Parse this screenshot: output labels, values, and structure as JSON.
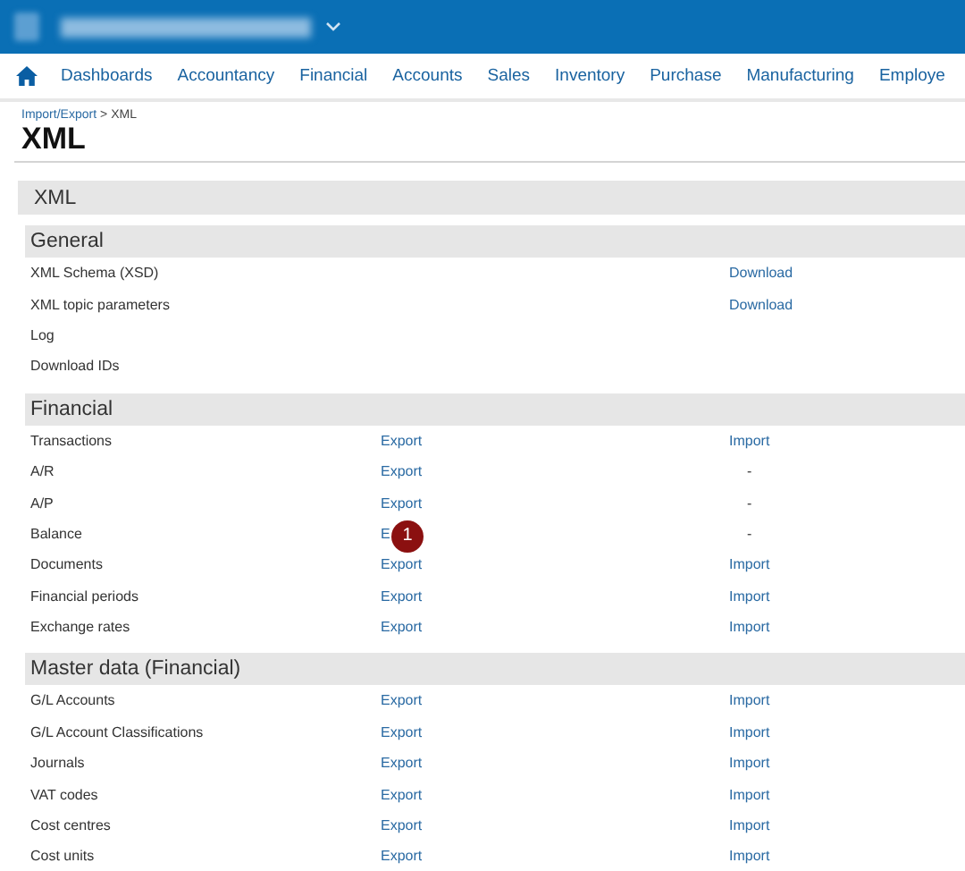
{
  "nav": {
    "items": [
      "Dashboards",
      "Accountancy",
      "Financial",
      "Accounts",
      "Sales",
      "Inventory",
      "Purchase",
      "Manufacturing",
      "Employe"
    ]
  },
  "breadcrumb": {
    "link": "Import/Export",
    "separator": ">",
    "current": "XML"
  },
  "title": "XML",
  "panel_title": "XML",
  "sections": [
    {
      "title": "General",
      "rows": [
        {
          "label": "XML Schema (XSD)",
          "col_3": {
            "text": "Download",
            "kind": "link"
          }
        },
        {
          "label": "XML topic parameters",
          "col_3": {
            "text": "Download",
            "kind": "link"
          }
        },
        {
          "label": "Log"
        },
        {
          "label": "Download IDs"
        }
      ]
    },
    {
      "title": "Financial",
      "rows": [
        {
          "label": "Transactions",
          "col_2": {
            "text": "Export",
            "kind": "link"
          },
          "col_3": {
            "text": "Import",
            "kind": "link"
          }
        },
        {
          "label": "A/R",
          "col_2": {
            "text": "Export",
            "kind": "link"
          },
          "col_3": {
            "text": "-",
            "kind": "text"
          }
        },
        {
          "label": "A/P",
          "col_2": {
            "text": "Export",
            "kind": "link"
          },
          "col_3": {
            "text": "-",
            "kind": "text"
          }
        },
        {
          "label": "Balance",
          "col_2": {
            "text": "E",
            "kind": "link"
          },
          "badge": "1",
          "col_3": {
            "text": "-",
            "kind": "text"
          }
        },
        {
          "label": "Documents",
          "col_2": {
            "text": "Export",
            "kind": "link"
          },
          "col_3": {
            "text": "Import",
            "kind": "link"
          }
        },
        {
          "label": "Financial periods",
          "col_2": {
            "text": "Export",
            "kind": "link"
          },
          "col_3": {
            "text": "Import",
            "kind": "link"
          }
        },
        {
          "label": "Exchange rates",
          "col_2": {
            "text": "Export",
            "kind": "link"
          },
          "col_3": {
            "text": "Import",
            "kind": "link"
          }
        }
      ]
    },
    {
      "title": "Master data (Financial)",
      "rows": [
        {
          "label": "G/L Accounts",
          "col_2": {
            "text": "Export",
            "kind": "link"
          },
          "col_3": {
            "text": "Import",
            "kind": "link"
          }
        },
        {
          "label": "G/L Account Classifications",
          "col_2": {
            "text": "Export",
            "kind": "link"
          },
          "col_3": {
            "text": "Import",
            "kind": "link"
          }
        },
        {
          "label": "Journals",
          "col_2": {
            "text": "Export",
            "kind": "link"
          },
          "col_3": {
            "text": "Import",
            "kind": "link"
          }
        },
        {
          "label": "VAT codes",
          "col_2": {
            "text": "Export",
            "kind": "link"
          },
          "col_3": {
            "text": "Import",
            "kind": "link"
          }
        },
        {
          "label": "Cost centres",
          "col_2": {
            "text": "Export",
            "kind": "link"
          },
          "col_3": {
            "text": "Import",
            "kind": "link"
          }
        },
        {
          "label": "Cost units",
          "col_2": {
            "text": "Export",
            "kind": "link"
          },
          "col_3": {
            "text": "Import",
            "kind": "link"
          }
        }
      ]
    }
  ]
}
